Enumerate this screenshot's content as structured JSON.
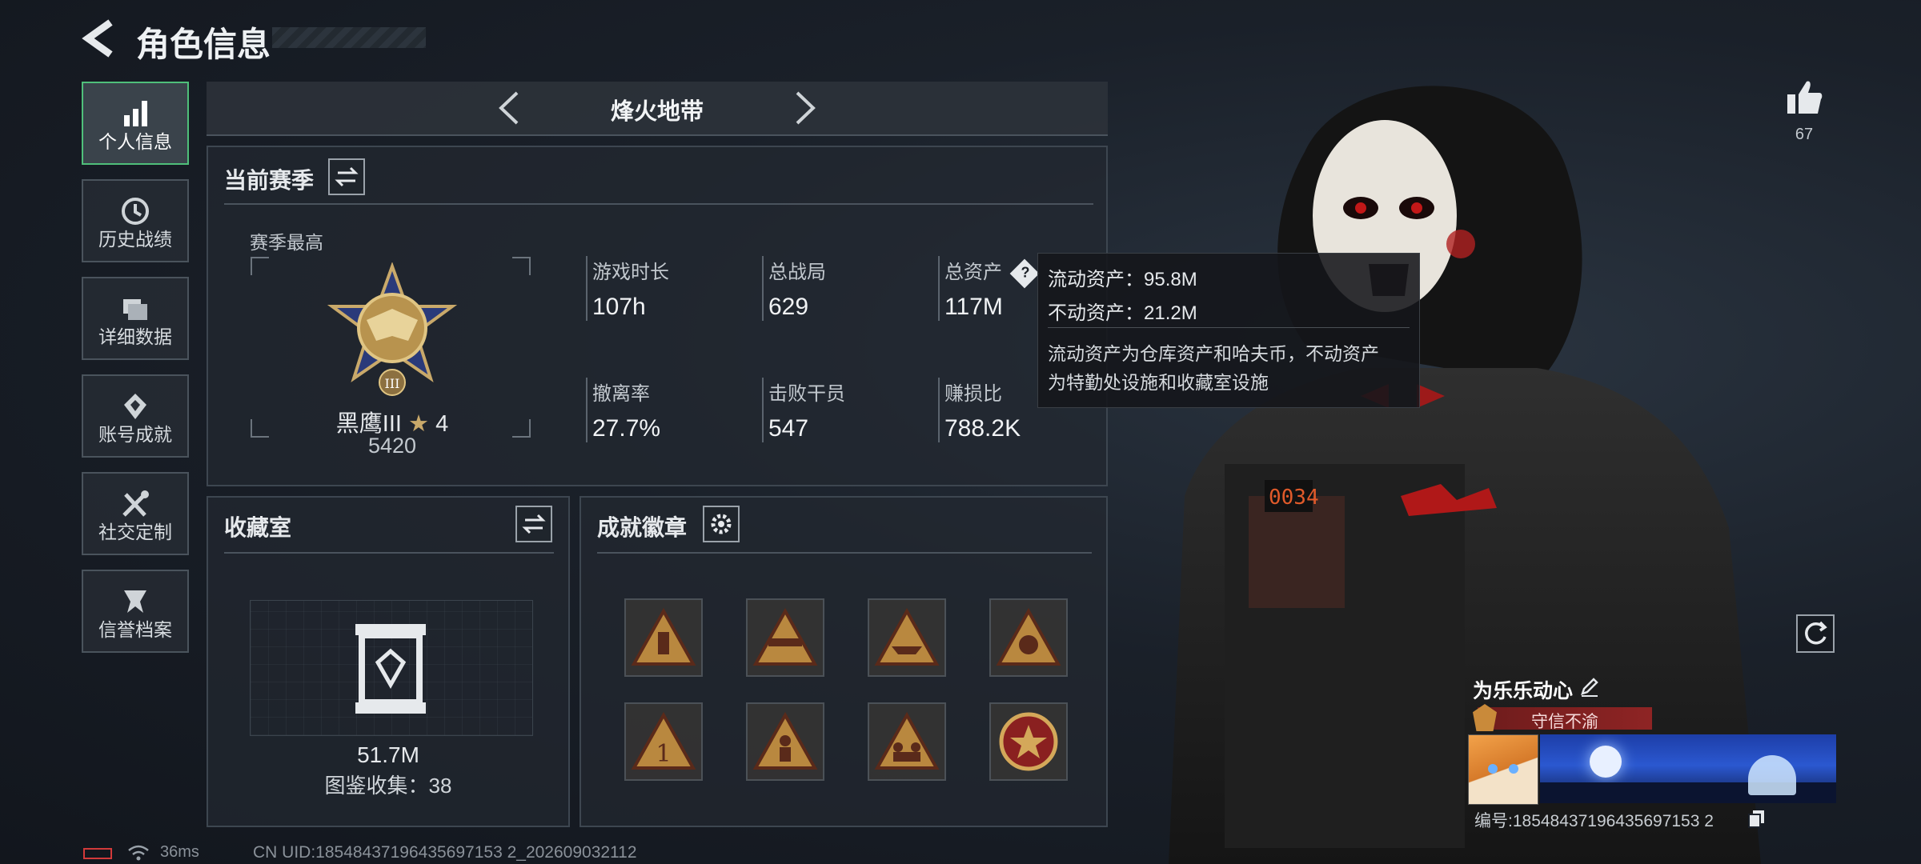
{
  "header": {
    "title": "角色信息"
  },
  "sidebar": {
    "items": [
      {
        "label": "个人信息",
        "icon": "bar-chart-icon",
        "active": true
      },
      {
        "label": "历史战绩",
        "icon": "history-clock-icon"
      },
      {
        "label": "详细数据",
        "icon": "folder-icon"
      },
      {
        "label": "账号成就",
        "icon": "achievement-icon"
      },
      {
        "label": "社交定制",
        "icon": "tools-icon"
      },
      {
        "label": "信誉档案",
        "icon": "reputation-icon"
      }
    ]
  },
  "mode": {
    "title": "烽火地带"
  },
  "season": {
    "title": "当前赛季",
    "best_label": "赛季最高",
    "rank_name": "黑鹰III",
    "rank_stars": "4",
    "rank_score": "5420",
    "stats": [
      {
        "label": "游戏时长",
        "value": "107h"
      },
      {
        "label": "总战局",
        "value": "629"
      },
      {
        "label": "总资产",
        "value": "117M"
      },
      {
        "label": "撤离率",
        "value": "27.7%"
      },
      {
        "label": "击败干员",
        "value": "547"
      },
      {
        "label": "赚损比",
        "value": "788.2K"
      }
    ]
  },
  "tooltip": {
    "line1": "流动资产：95.8M",
    "line2": "不动资产：21.2M",
    "desc1": "流动资产为仓库资产和哈夫币，不动资产",
    "desc2": "为特勤处设施和收藏室设施"
  },
  "collection": {
    "title": "收藏室",
    "value": "51.7M",
    "count_text": "图鉴收集：38"
  },
  "achievements": {
    "title": "成就徽章",
    "badges": [
      "badge-tower-icon",
      "badge-gun-icon",
      "badge-ship-icon",
      "badge-cash-icon",
      "badge-number-one-icon",
      "badge-soldier-icon",
      "badge-team-icon",
      "badge-star-seal-icon"
    ]
  },
  "likes": {
    "count": "67"
  },
  "player": {
    "name": "为乐乐动心",
    "title_badge": "守信不渝",
    "id_text": "编号:18548437196435697153 2"
  },
  "footer": {
    "ping": "36ms",
    "uid": "CN UID:18548437196435697153 2_202609032112"
  },
  "colors": {
    "accent_green": "#4fbf7a",
    "title_red": "#8e2424",
    "gold": "#c9a96a"
  }
}
